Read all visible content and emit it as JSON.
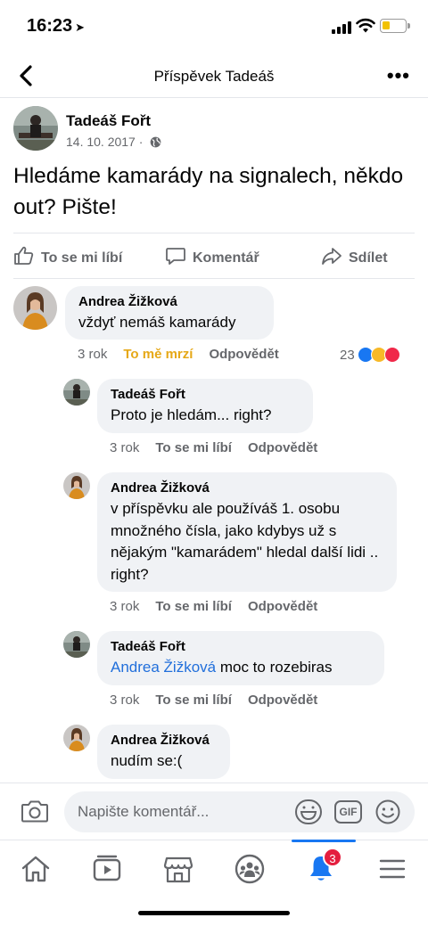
{
  "status_bar": {
    "time": "16:23",
    "location_arrow": "location-arrow-icon"
  },
  "nav": {
    "title": "Příspěvek Tadeáš",
    "back_icon": "chevron-left-icon",
    "more_icon": "more-icon",
    "more_label": "•••"
  },
  "post": {
    "author": "Tadeáš Fořt",
    "date": "14. 10. 2017 ·",
    "privacy_icon": "globe-icon",
    "text": "Hledáme kamarády na signalech, někdo out? Pište!"
  },
  "actions": {
    "like": "To se mi líbí",
    "comment": "Komentář",
    "share": "Sdílet"
  },
  "comments": [
    {
      "author": "Andrea Žižková",
      "text": "vždyť nemáš kamarády",
      "time": "3 rok",
      "reaction_label": "To mě mrzí",
      "reply": "Odpovědět",
      "reaction_count": "23"
    },
    {
      "author": "Tadeáš Fořt",
      "text": "Proto je hledám... right?",
      "time": "3 rok",
      "like": "To se mi líbí",
      "reply": "Odpovědět"
    },
    {
      "author": "Andrea Žižková",
      "text": "v příspěvku ale používáš 1. osobu množného čísla, jako kdybys už s nějakým \"kamarádem\" hledal další lidi .. right?",
      "time": "3 rok",
      "like": "To se mi líbí",
      "reply": "Odpovědět"
    },
    {
      "author": "Tadeáš Fořt",
      "mention": "Andrea Žižková",
      "text": " moc to rozebiras",
      "time": "3 rok",
      "like": "To se mi líbí",
      "reply": "Odpovědět"
    },
    {
      "author": "Andrea Žižková",
      "text": "nudím se:("
    }
  ],
  "composer": {
    "placeholder": "Napište komentář...",
    "gif_label": "GIF"
  },
  "tabbar": {
    "notifications_badge": "3"
  },
  "colors": {
    "accent": "#1877f2",
    "react_sad": "#e6a817",
    "bubble": "#f0f2f5",
    "badge": "#e41e3f"
  }
}
